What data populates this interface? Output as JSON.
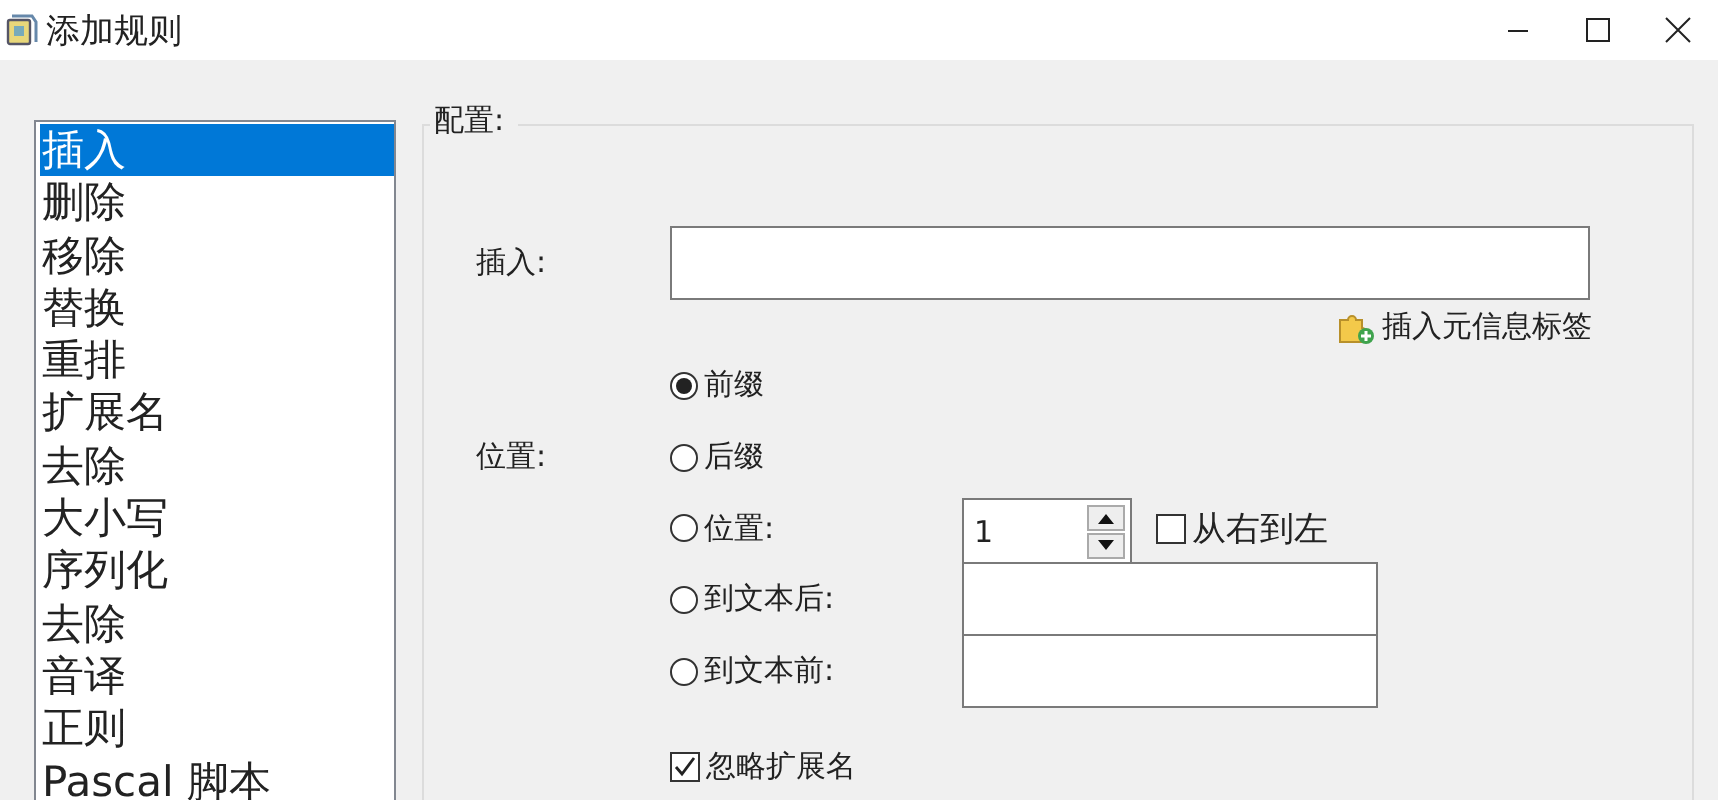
{
  "window": {
    "title": "添加规则"
  },
  "rules": [
    {
      "label": "插入",
      "selected": true
    },
    {
      "label": "删除",
      "selected": false
    },
    {
      "label": "移除",
      "selected": false
    },
    {
      "label": "替换",
      "selected": false
    },
    {
      "label": "重排",
      "selected": false
    },
    {
      "label": "扩展名",
      "selected": false
    },
    {
      "label": "去除",
      "selected": false
    },
    {
      "label": "大小写",
      "selected": false
    },
    {
      "label": "序列化",
      "selected": false
    },
    {
      "label": "去除",
      "selected": false
    },
    {
      "label": "音译",
      "selected": false
    },
    {
      "label": "正则",
      "selected": false
    },
    {
      "label": "Pascal 脚本",
      "selected": false
    }
  ],
  "config": {
    "title": "配置:",
    "insert_label": "插入:",
    "meta_tag_link": "插入元信息标签",
    "position_label": "位置:",
    "positions": [
      {
        "label": "前缀",
        "selected": true,
        "kind": "plain"
      },
      {
        "label": "后缀",
        "selected": false,
        "kind": "plain"
      },
      {
        "label": "位置:",
        "selected": false,
        "kind": "spin"
      },
      {
        "label": "到文本后:",
        "selected": false,
        "kind": "text"
      },
      {
        "label": "到文本前:",
        "selected": false,
        "kind": "text"
      }
    ],
    "spin_value": "1",
    "right_to_left": {
      "label": "从右到左",
      "checked": false
    },
    "ignore_extension": {
      "label": "忽略扩展名",
      "checked": true
    }
  }
}
